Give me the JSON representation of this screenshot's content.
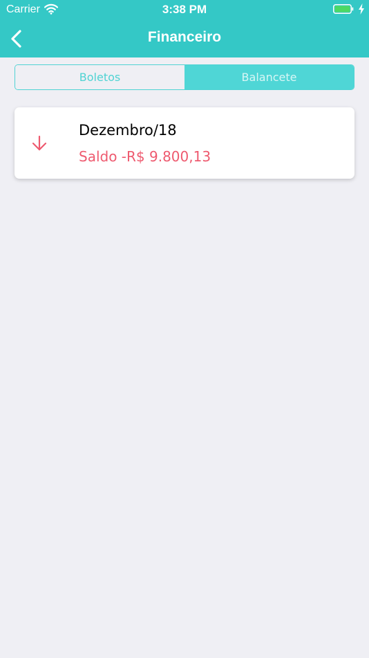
{
  "status_bar": {
    "carrier": "Carrier",
    "time": "3:38 PM",
    "wifi_icon": "wifi-icon",
    "battery_icon": "battery-icon",
    "charging_icon": "charging-bolt-icon"
  },
  "nav": {
    "title": "Financeiro",
    "back_icon": "chevron-left-icon"
  },
  "tabs": [
    {
      "label": "Boletos",
      "selected": false
    },
    {
      "label": "Balancete",
      "selected": true
    }
  ],
  "balance_items": [
    {
      "month": "Dezembro/18",
      "balance": "Saldo -R$ 9.800,13",
      "icon": "arrow-down-icon"
    }
  ],
  "colors": {
    "header": "#34c8c6",
    "accent": "#4fd3d3",
    "negative": "#ee5a6f",
    "background": "#efeff4"
  }
}
